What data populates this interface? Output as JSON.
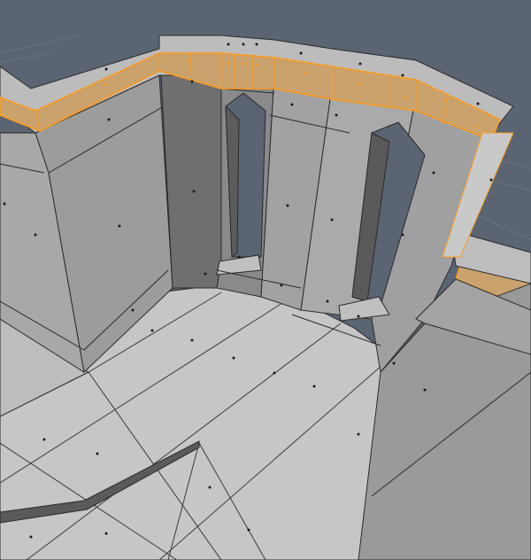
{
  "viewport": {
    "mode": "edit-mode",
    "selection": "face-ring",
    "colors": {
      "background": "#5a6472",
      "grid": "#6a7482",
      "floor": "#c6c6c6",
      "floor_dark": "#b7b7b7",
      "wall_light": "#a8a8a8",
      "wall_mid": "#979797",
      "wall_dark": "#6f6f6f",
      "wall_darker": "#575757",
      "top_face": "#bcbcbc",
      "selected_fill": "#caa26e",
      "selected_edge": "#ff9a1a",
      "edge": "#2b2b2b",
      "vertex": "#1a1a1a"
    }
  }
}
